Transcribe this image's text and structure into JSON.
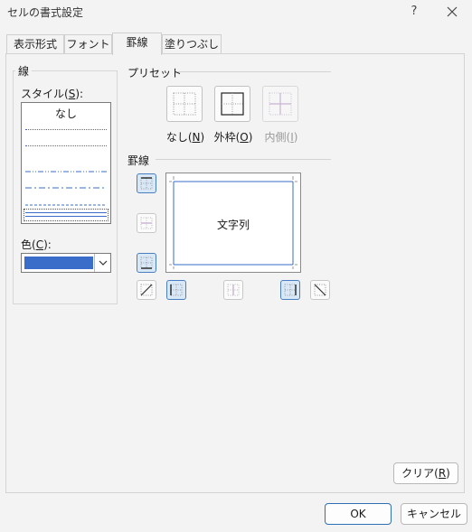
{
  "window": {
    "title": "セルの書式設定",
    "help_label": "?",
    "close_icon": "close-icon"
  },
  "tabs": [
    {
      "label": "表示形式",
      "active": false
    },
    {
      "label": "フォント",
      "active": false
    },
    {
      "label": "罫線",
      "active": true
    },
    {
      "label": "塗りつぶし",
      "active": false
    }
  ],
  "line_group": {
    "title": "線",
    "style_label_prefix": "スタイル(",
    "style_label_key": "S",
    "style_label_suffix": "):",
    "style_none": "なし",
    "color_label_prefix": "色(",
    "color_label_key": "C",
    "color_label_suffix": "):",
    "selected_color": "#3a6dc9"
  },
  "presets": {
    "title": "プリセット",
    "items": [
      {
        "prefix": "なし(",
        "key": "N",
        "suffix": ")",
        "enabled": true
      },
      {
        "prefix": "外枠(",
        "key": "O",
        "suffix": ")",
        "enabled": true
      },
      {
        "prefix": "内側(",
        "key": "I",
        "suffix": ")",
        "enabled": false
      }
    ]
  },
  "border": {
    "title": "罫線",
    "preview_text": "文字列"
  },
  "buttons": {
    "clear_prefix": "クリア(",
    "clear_key": "R",
    "clear_suffix": ")",
    "ok": "OK",
    "cancel": "キャンセル"
  },
  "colors": {
    "accent": "#3a6dc9",
    "pressed_border": "#4a7fbf"
  }
}
